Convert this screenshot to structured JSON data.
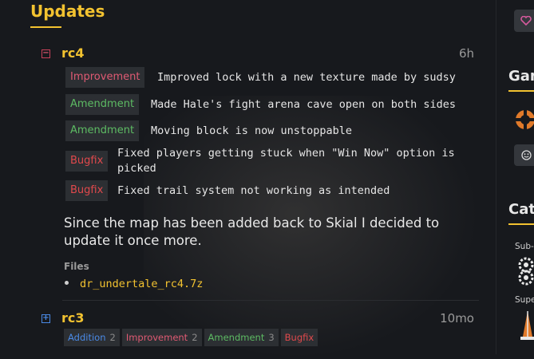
{
  "section": {
    "title": "Updates"
  },
  "releases": [
    {
      "name": "rc4",
      "time": "6h",
      "expanded": true,
      "changes": [
        {
          "type": "Improvement",
          "text": "Improved lock with a new texture made by sudsy"
        },
        {
          "type": "Amendment",
          "text": "Made Hale's fight arena cave open on both sides"
        },
        {
          "type": "Amendment",
          "text": "Moving block is now unstoppable"
        },
        {
          "type": "Bugfix",
          "text": "Fixed players getting stuck when \"Win Now\" option is picked"
        },
        {
          "type": "Bugfix",
          "text": "Fixed trail system not working as intended"
        }
      ],
      "description": "Since the map has been added back to Skial I decided to update it once more.",
      "files_label": "Files",
      "files": [
        "dr_undertale_rc4.7z"
      ]
    },
    {
      "name": "rc3",
      "time": "10mo",
      "expanded": false,
      "tags": [
        {
          "label": "Addition",
          "count": "2"
        },
        {
          "label": "Improvement",
          "count": "2"
        },
        {
          "label": "Amendment",
          "count": "3"
        },
        {
          "label": "Bugfix",
          "count": ""
        }
      ]
    }
  ],
  "sidebar": {
    "heading_game": "Gam",
    "heading_category": "Cat",
    "sub_label": "Sub-",
    "super_label": "Supe"
  },
  "colors": {
    "accent": "#f2c230",
    "improvement": "#e05a73",
    "amendment": "#5dbb63",
    "bugfix": "#e0494c",
    "addition": "#4a8ae6"
  }
}
